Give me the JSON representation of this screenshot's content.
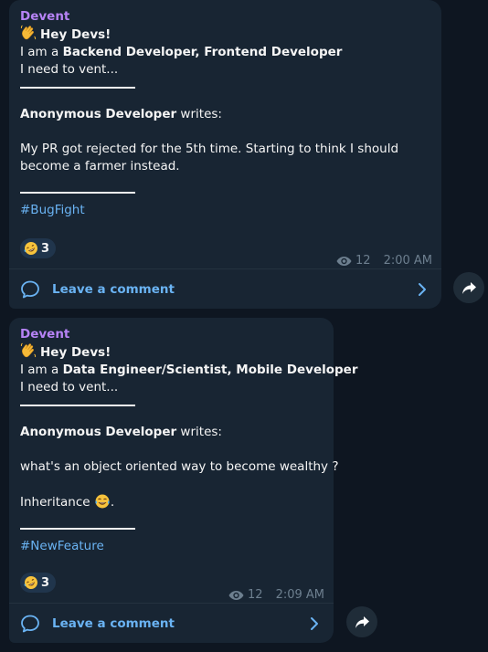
{
  "posts": [
    {
      "channel": "Devent",
      "greeting": "Hey Devs!",
      "role_prefix": "I am a ",
      "roles": "Backend Developer, Frontend Developer",
      "vent_line": "I need to vent...",
      "author": "Anonymous Developer",
      "writes": " writes:",
      "message_lines": [
        "My PR got rejected for the 5th time. Starting to think I should",
        "become a farmer instead."
      ],
      "hashtag": "#BugFight",
      "reaction_icon": "rofl-face",
      "reaction_count": "3",
      "views": "12",
      "time": "2:00 AM",
      "comment_label": "Leave a comment"
    },
    {
      "channel": "Devent",
      "greeting": "Hey Devs!",
      "role_prefix": "I am a ",
      "roles": "Data Engineer/Scientist, Mobile Developer",
      "vent_line": "I need to vent...",
      "author": "Anonymous Developer",
      "writes": " writes:",
      "message_lines": [
        "what's an object oriented way to become wealthy ?"
      ],
      "punchline": "Inheritance",
      "punchline_suffix": ".",
      "punchline_emoji": "tears-of-joy-face",
      "hashtag": "#NewFeature",
      "reaction_icon": "rofl-face",
      "reaction_count": "3",
      "views": "12",
      "time": "2:09 AM",
      "comment_label": "Leave a comment"
    }
  ],
  "colors": {
    "background": "#0e1621",
    "bubble": "#182533",
    "channel_name": "#b683f5",
    "link": "#6ab3f3",
    "meta": "#6d7f8f",
    "reaction_bg": "#20354c"
  },
  "icons": {
    "greeting": "waving-hand-icon",
    "views": "eye-icon",
    "comment": "comment-bubble-icon",
    "chevron": "chevron-right-icon",
    "share": "share-arrow-icon"
  }
}
